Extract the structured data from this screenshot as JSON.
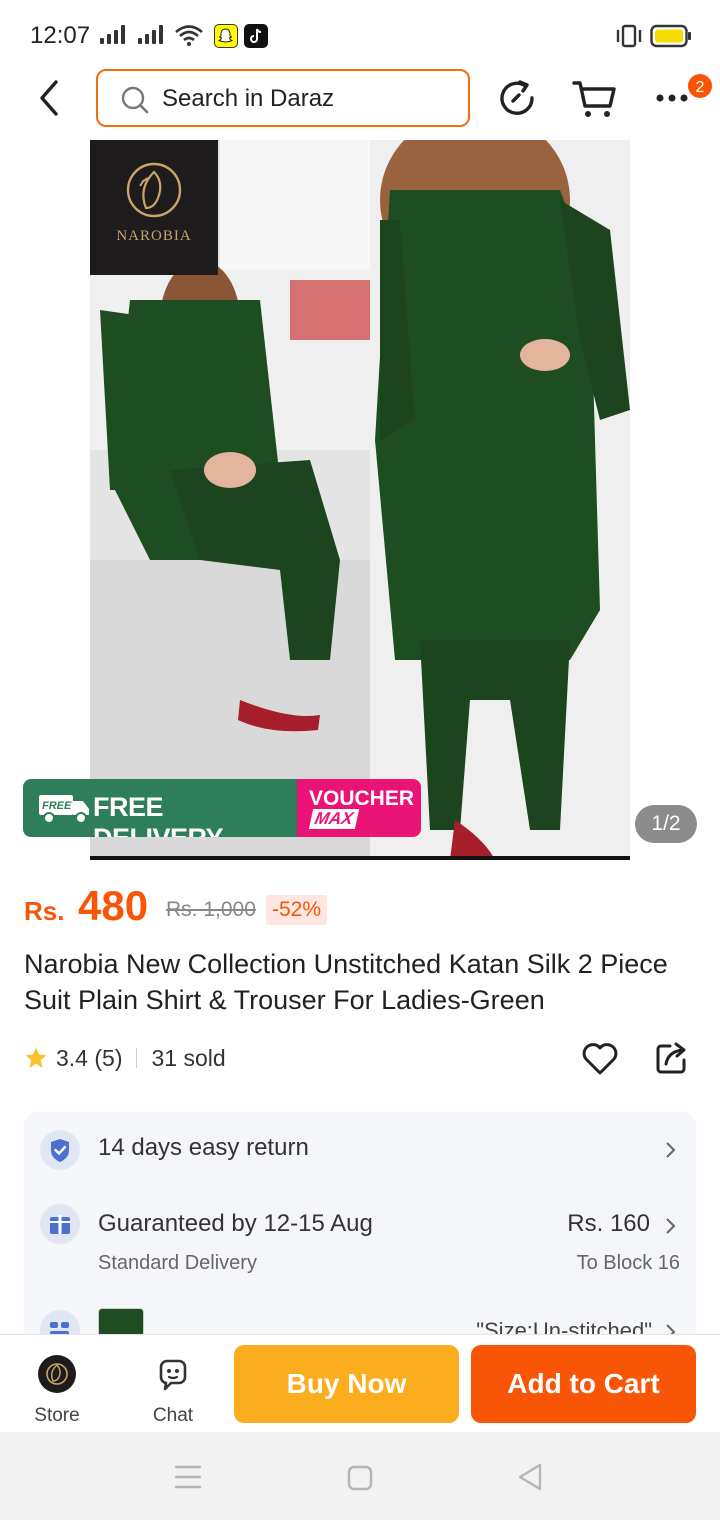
{
  "status_bar": {
    "time": "12:07",
    "icons": [
      "signal-icon",
      "signal-icon",
      "wifi-icon",
      "snapchat-icon",
      "tiktok-icon",
      "vibrate-icon",
      "battery-icon"
    ]
  },
  "header": {
    "search_placeholder": "Search in Daraz",
    "notification_count": "2",
    "icons": [
      "back-icon",
      "search-icon",
      "history-icon",
      "cart-icon",
      "more-icon"
    ]
  },
  "gallery": {
    "brand_text": "NAROBIA",
    "page_indicator": "1/2",
    "free_delivery": {
      "icon_label": "FREE",
      "label": "FREE DELIVERY",
      "voucher_top": "VOUCHER",
      "voucher_bottom": "MAX"
    }
  },
  "product": {
    "currency": "Rs.",
    "price": "480",
    "original_price": "Rs. 1,000",
    "discount": "-52%",
    "title": "Narobia New Collection Unstitched Katan Silk 2 Piece Suit Plain Shirt & Trouser For Ladies-Green",
    "rating": "3.4 (5)",
    "sold": "31 sold"
  },
  "info": {
    "return_policy": "14 days easy return",
    "delivery_guarantee": "Guaranteed by 12-15 Aug",
    "delivery_type": "Standard Delivery",
    "delivery_fee": "Rs. 160",
    "delivery_location": "To Block 16",
    "variant": "\"Size:Un-stitched\""
  },
  "bottom_bar": {
    "store_label": "Store",
    "chat_label": "Chat",
    "buy_now": "Buy Now",
    "add_to_cart": "Add to Cart"
  },
  "colors": {
    "brand_orange": "#f85606",
    "buy_now_yellow": "#fbad1e",
    "free_delivery_green": "#2e7d5b",
    "voucher_pink": "#ec1377",
    "suit_green": "#1f4d22"
  }
}
